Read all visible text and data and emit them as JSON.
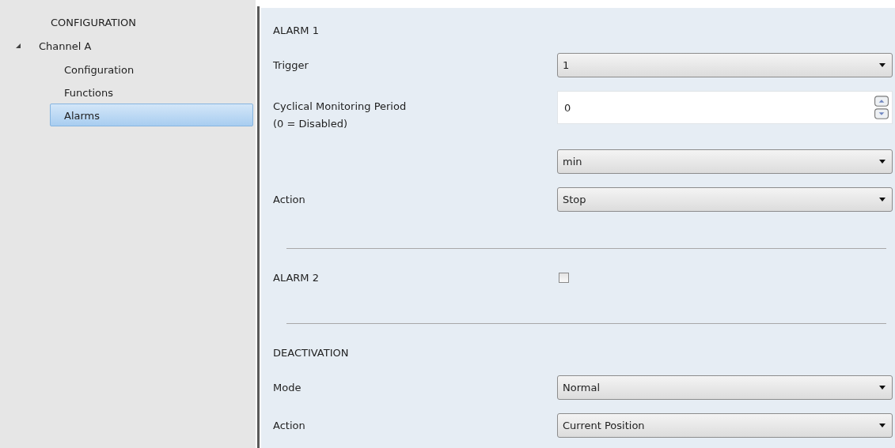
{
  "sidebar": {
    "title": "CONFIGURATION",
    "items": [
      {
        "label": "Channel A",
        "expanded": true,
        "selected": false,
        "children": [
          {
            "label": "Configuration",
            "selected": false
          },
          {
            "label": "Functions",
            "selected": false
          },
          {
            "label": "Alarms",
            "selected": true
          }
        ]
      }
    ]
  },
  "panel": {
    "rows": [
      {
        "kind": "heading",
        "label": "ALARM 1"
      },
      {
        "kind": "dropdown",
        "label": "Trigger",
        "value": "1"
      },
      {
        "kind": "spinner",
        "label": "Cyclical Monitoring Period\n(0 = Disabled)",
        "value": "0"
      },
      {
        "kind": "dropdown",
        "value": "min"
      },
      {
        "kind": "dropdown",
        "label": "Action",
        "value": "Stop"
      },
      {
        "kind": "separator"
      },
      {
        "kind": "checkbox",
        "label": "ALARM 2",
        "checked": false
      },
      {
        "kind": "separator"
      },
      {
        "kind": "heading",
        "label": "DEACTIVATION"
      },
      {
        "kind": "dropdown",
        "label": "Mode",
        "value": "Normal"
      },
      {
        "kind": "dropdown",
        "label": "Action",
        "value": "Current Position"
      }
    ]
  }
}
